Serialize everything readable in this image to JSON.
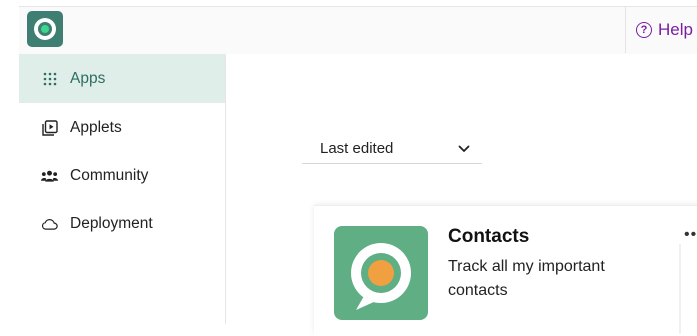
{
  "topbar": {
    "help_label": "Help"
  },
  "sidebar": {
    "items": [
      {
        "label": "Apps",
        "icon": "grid-dots-icon",
        "active": true
      },
      {
        "label": "Applets",
        "icon": "play-stack-icon",
        "active": false
      },
      {
        "label": "Community",
        "icon": "people-icon",
        "active": false
      },
      {
        "label": "Deployment",
        "icon": "cloud-icon",
        "active": false
      }
    ]
  },
  "main": {
    "sort_label": "Last edited",
    "card": {
      "title": "Contacts",
      "description": "Track all my important contacts",
      "icon": "contacts-app-icon"
    }
  },
  "colors": {
    "accent": "#3f7f73",
    "active_bg": "#dfeee8",
    "help": "#7a1fa2",
    "app_icon_bg": "#5fae84",
    "app_icon_dot": "#f0a040"
  }
}
